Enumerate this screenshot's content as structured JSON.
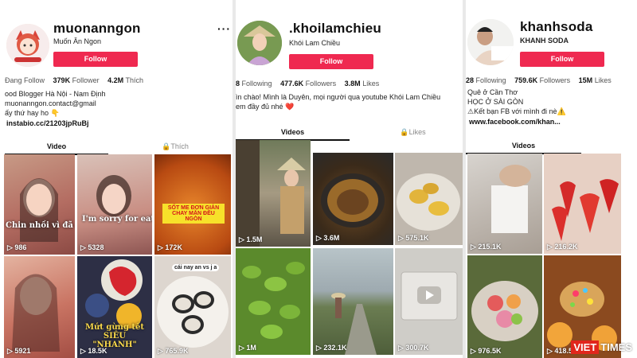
{
  "profiles": [
    {
      "username": "muonanngon",
      "display_name": "Muốn Ăn Ngon",
      "follow_label": "Follow",
      "more": "···",
      "stats": {
        "following_label": "Đang Follow",
        "followers_count": "379K",
        "followers_label": "Follower",
        "likes_count": "4.2M",
        "likes_label": "Thích"
      },
      "bio": [
        "ood Blogger Hà Nội - Nam Định",
        "muonanngon.contact@gmail",
        "ấy thứ hay ho 👇"
      ],
      "link": "instabio.cc/21203jpRuBj",
      "tabs": {
        "videos": "Video",
        "likes": "🔒Thích"
      },
      "videos": [
        {
          "views": "▷ 986",
          "caption": "Chin nhồi vì đã ăn"
        },
        {
          "views": "▷ 5328",
          "caption": "I'm sorry for eating"
        },
        {
          "views": "▷ 172K",
          "caption": "SỐT ME ĐƠN GIẢN CHAY MẶN ĐỀU NGON"
        },
        {
          "views": "▷ 5921",
          "caption": ""
        },
        {
          "views": "▷ 18.5K",
          "caption": "Mứt gừng tết SIÊU \"NHANH\""
        },
        {
          "views": "▷ 765.9K",
          "caption": "cái nay an vs j a"
        }
      ]
    },
    {
      "username": ".khoilamchieu",
      "display_name": "Khói Lam Chiều",
      "follow_label": "Follow",
      "stats": {
        "following_count": "8",
        "following_label": "Following",
        "followers_count": "477.6K",
        "followers_label": "Followers",
        "likes_count": "3.8M",
        "likes_label": "Likes"
      },
      "bio": [
        "ìn chào! Mình là Duyên, mọi người qua youtube Khói Lam Chiều",
        "em đầy đủ nhé ❤️"
      ],
      "tabs": {
        "videos": "Videos",
        "likes": "🔒Likes"
      },
      "videos": [
        {
          "views": "▷ 1.5M"
        },
        {
          "views": "▷ 3.6M"
        },
        {
          "views": "▷ 575.1K"
        },
        {
          "views": "▷ 1M"
        },
        {
          "views": "▷ 232.1K"
        },
        {
          "views": "▷ 300.7K"
        }
      ]
    },
    {
      "username": "khanhsoda",
      "display_name": "KHANH SODA",
      "follow_label": "Follow",
      "stats": {
        "following_count": "28",
        "following_label": "Following",
        "followers_count": "759.6K",
        "followers_label": "Followers",
        "likes_count": "15M",
        "likes_label": "Likes"
      },
      "bio": [
        "Quê ở Cần Thơ",
        "HỌC Ở SÀI GÒN",
        "⚠Kết bạn FB với mình đi nè⚠️"
      ],
      "link": "www.facebook.com/khan...",
      "tabs": {
        "videos": "Videos"
      },
      "videos": [
        {
          "views": "▷ 215.1K"
        },
        {
          "views": "▷ 216.2K"
        },
        {
          "views": "▷ 976.5K"
        },
        {
          "views": "▷ 418.5K"
        }
      ]
    }
  ],
  "watermark": {
    "box": "VIET",
    "text": "TIMES"
  },
  "colors": {
    "follow": "#ef2950"
  }
}
